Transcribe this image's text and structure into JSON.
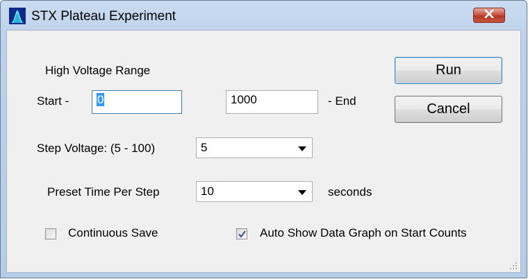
{
  "window": {
    "title": "STX Plateau Experiment",
    "icon": "plateau-curve-icon",
    "close_icon": "close-x-icon"
  },
  "hv_range": {
    "label": "High Voltage Range",
    "start_label": "Start -",
    "start_value": "0",
    "end_value": "1000",
    "end_label": "- End"
  },
  "step": {
    "label": "Step Voltage: (5 - 100)",
    "value": "5"
  },
  "preset": {
    "label": "Preset Time Per Step",
    "value": "10",
    "unit": "seconds"
  },
  "options": {
    "continuous_save": {
      "label": "Continuous Save",
      "checked": false
    },
    "auto_show": {
      "label": "Auto Show Data Graph on Start Counts",
      "checked": true
    }
  },
  "buttons": {
    "run": "Run",
    "cancel": "Cancel"
  },
  "colors": {
    "title_bar": "#bcd1ea",
    "close_red": "#c95746",
    "client_bg": "#f0f0f0",
    "selection": "#3399ff"
  }
}
